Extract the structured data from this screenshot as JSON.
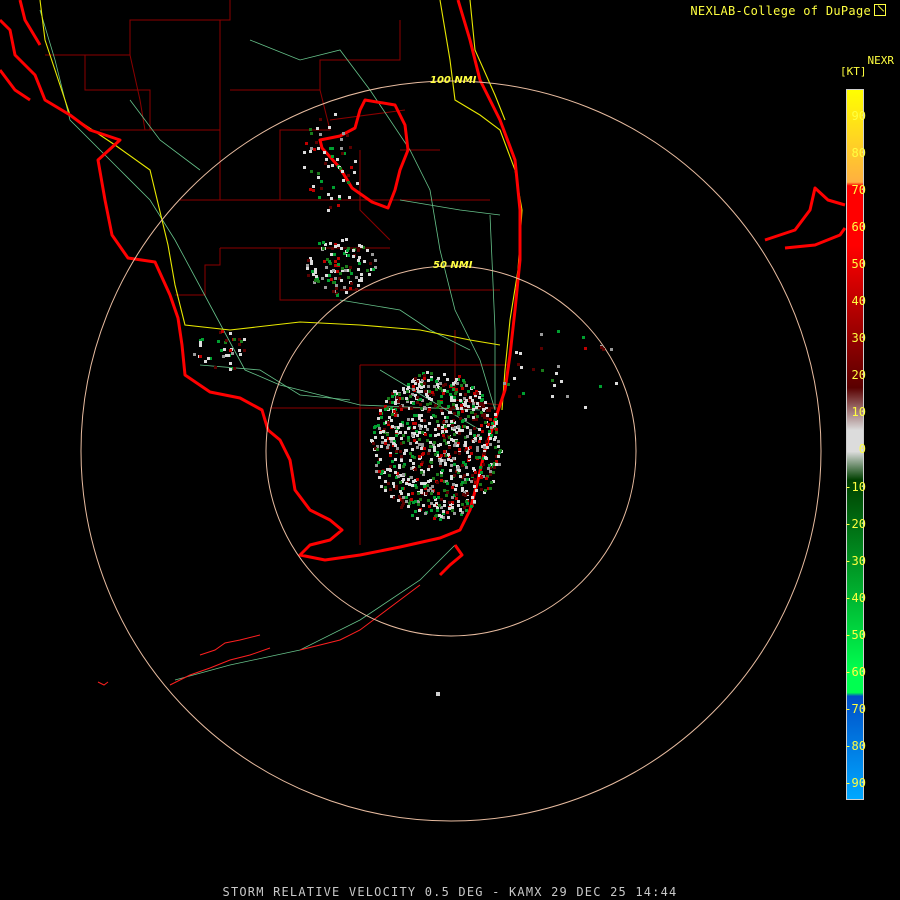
{
  "credit": {
    "text": "NEXLAB-College of DuPage"
  },
  "product": "NEXR",
  "legend": {
    "units": "[KT]",
    "ticks": [
      "90",
      "80",
      "70",
      "60",
      "50",
      "40",
      "30",
      "20",
      "10",
      "0",
      "-10",
      "-20",
      "-30",
      "-40",
      "-50",
      "-60",
      "-70",
      "-80",
      "-90"
    ],
    "colors": {
      "max": "#ffff00",
      "orange": "#ffb040",
      "red": "#ff0000",
      "darkred": "#5a0000",
      "gray": "#dcdcdc",
      "darkgreen": "#004000",
      "green": "#00ff50",
      "blue": "#0050c8",
      "lightblue": "#00a8ff"
    }
  },
  "rings": [
    {
      "label": "100 NMI"
    },
    {
      "label": "50 NMI"
    }
  ],
  "footer": "STORM RELATIVE VELOCITY 0.5 DEG - KAMX 29 DEC 25 14:44"
}
